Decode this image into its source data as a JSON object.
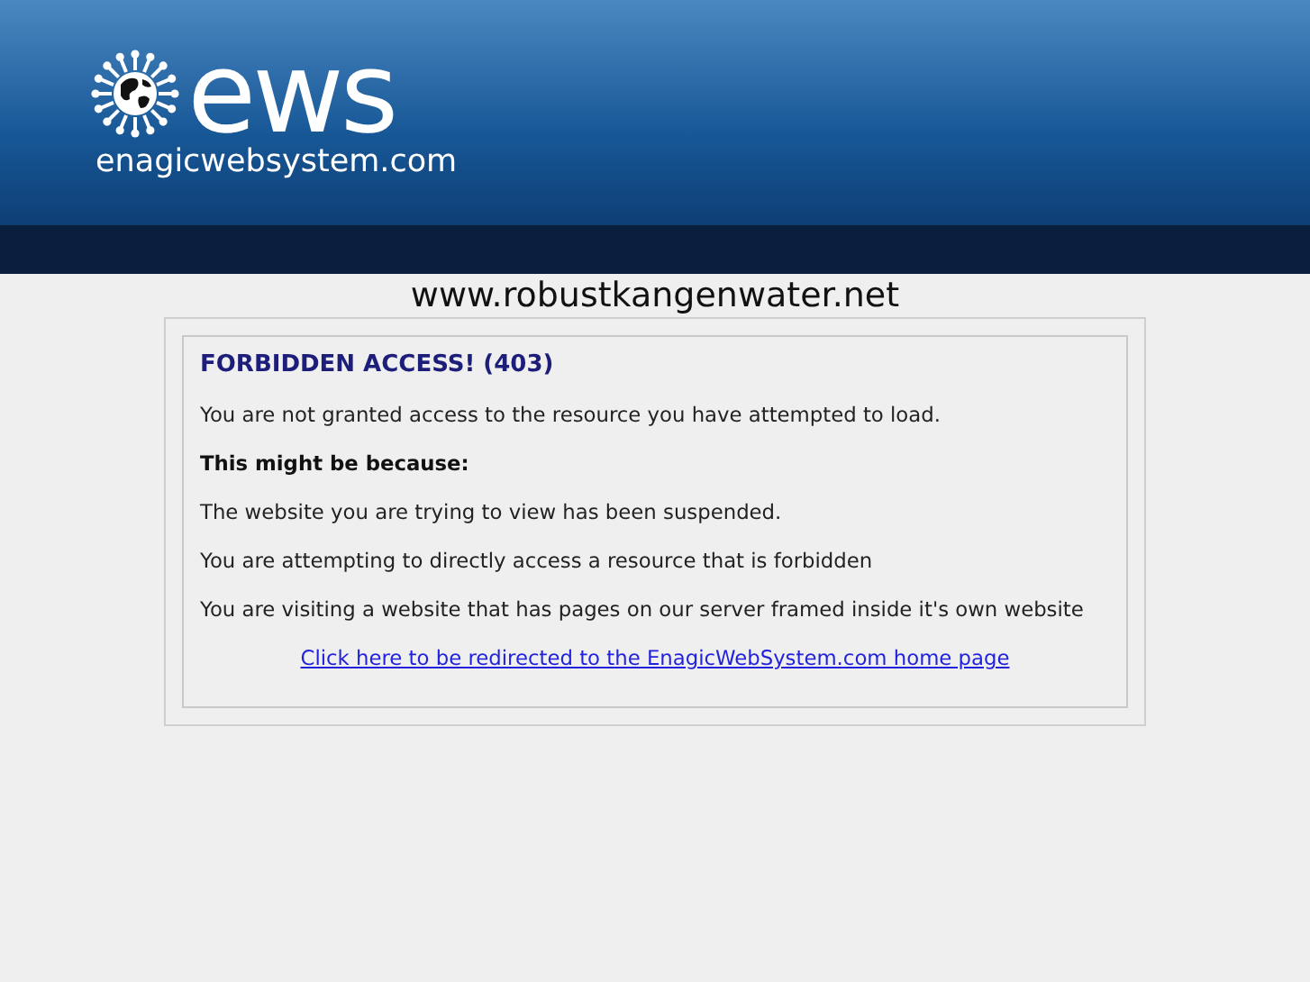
{
  "header": {
    "logo_text": "ews",
    "logo_domain": "enagicwebsystem.com"
  },
  "site_title": "www.robustkangenwater.net",
  "message": [
    {
      "kind": "heading",
      "text": "FORBIDDEN ACCESS! (403)"
    },
    {
      "kind": "text",
      "text": "You are not granted access to the resource you have attempted to load."
    },
    {
      "kind": "bold",
      "text": "This might be because:"
    },
    {
      "kind": "text",
      "text": "The website you are trying to view has been suspended."
    },
    {
      "kind": "text",
      "text": "You are attempting to directly access a resource that is forbidden"
    },
    {
      "kind": "text",
      "text": "You are visiting a website that has pages on our server framed inside it's own website"
    },
    {
      "kind": "link",
      "text": "Click here to be redirected to the EnagicWebSystem.com home page"
    }
  ]
}
